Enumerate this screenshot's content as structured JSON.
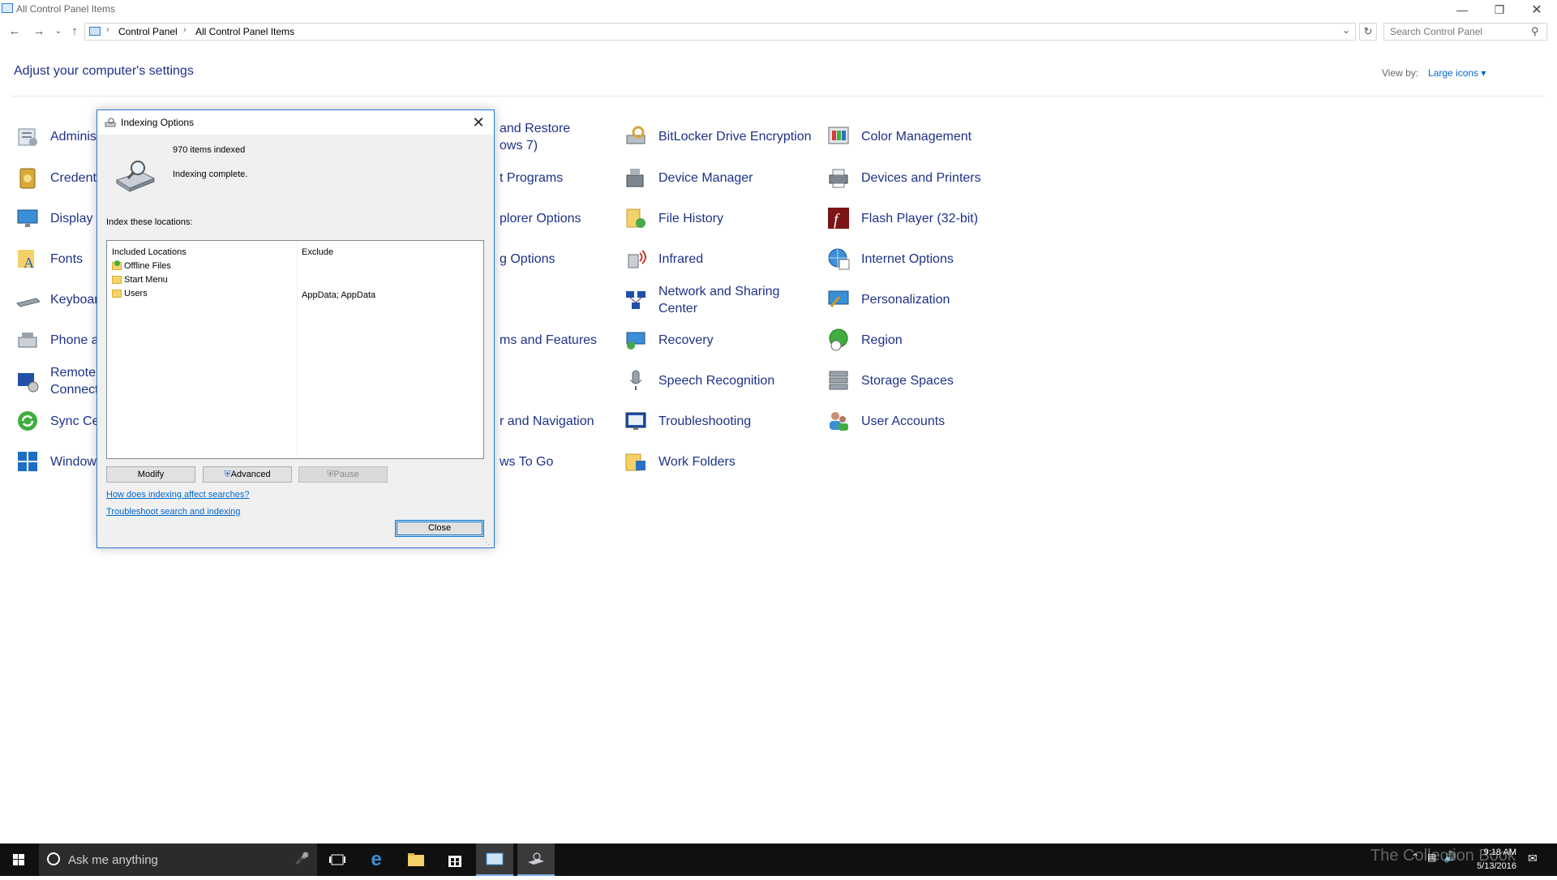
{
  "window": {
    "title": "All Control Panel Items"
  },
  "address": {
    "crumbs": [
      "Control Panel",
      "All Control Panel Items"
    ],
    "search_placeholder": "Search Control Panel"
  },
  "page": {
    "heading": "Adjust your computer's settings",
    "view_by_label": "View by:",
    "view_by_value": "Large icons"
  },
  "items": [
    "Adminis",
    "Credenti",
    "Display",
    "Fonts",
    "Keyboar",
    "Phone a",
    "Remote",
    "Connect",
    "Sync Cer",
    "Window",
    "and Restore",
    "ows 7)",
    "t Programs",
    "plorer Options",
    "g Options",
    "ms and Features",
    "r and Navigation",
    "ws To Go",
    "BitLocker Drive Encryption",
    "Device Manager",
    "File History",
    "Infrared",
    "Network and Sharing",
    "Center",
    "Recovery",
    "Speech Recognition",
    "Troubleshooting",
    "Work Folders",
    "Color Management",
    "Devices and Printers",
    "Flash Player (32-bit)",
    "Internet Options",
    "Personalization",
    "Region",
    "Storage Spaces",
    "User Accounts"
  ],
  "dialog": {
    "title": "Indexing Options",
    "items_indexed": "970 items indexed",
    "status": "Indexing complete.",
    "index_label": "Index these locations:",
    "col_included": "Included Locations",
    "col_exclude": "Exclude",
    "locations": [
      {
        "name": "Offline Files",
        "exclude": ""
      },
      {
        "name": "Start Menu",
        "exclude": ""
      },
      {
        "name": "Users",
        "exclude": "AppData; AppData"
      }
    ],
    "modify_label": "Modify",
    "advanced_label": "Advanced",
    "pause_label": "Pause",
    "link_affect": "How does indexing affect searches?",
    "link_troubleshoot": "Troubleshoot search and indexing",
    "close_label": "Close"
  },
  "taskbar": {
    "search_placeholder": "Ask me anything",
    "time": "9:18 AM",
    "date": "5/13/2016",
    "watermark": "The Collection Book"
  }
}
